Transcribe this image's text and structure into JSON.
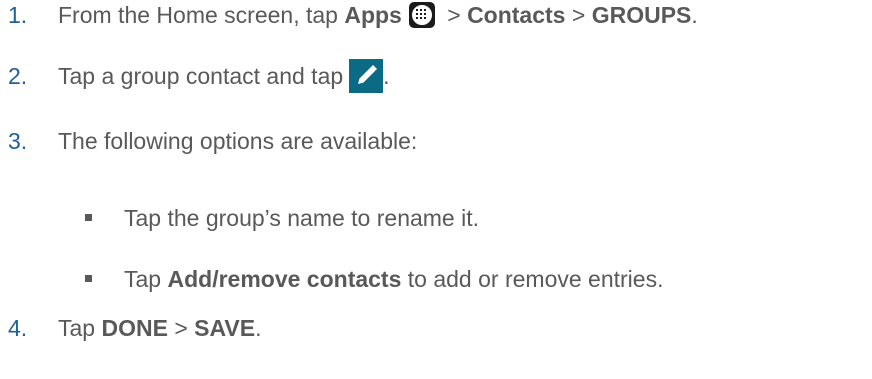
{
  "steps": [
    {
      "number": "1.",
      "t1": "From the Home screen, tap ",
      "b1": "Apps",
      "t2": " > ",
      "b2": "Contacts",
      "t3": " > ",
      "b3": "GROUPS",
      "t4": "."
    },
    {
      "number": "2.",
      "t1": "Tap a group contact and tap",
      "t2": "."
    },
    {
      "number": "3.",
      "t1": "The following options are available:"
    },
    {
      "number": "4.",
      "t1": "Tap ",
      "b1": "DONE",
      "t2": " > ",
      "b2": "SAVE",
      "t3": "."
    }
  ],
  "bullets": [
    {
      "t1": "Tap the group’s name to rename it."
    },
    {
      "t1": "Tap ",
      "b1": "Add/remove contacts",
      "t2": " to add or remove entries."
    }
  ],
  "icons": {
    "apps": "apps-grid-icon",
    "edit": "pencil-edit-icon",
    "edit_color": "#0b6b84",
    "number_color": "#1f5f9c",
    "text_color": "#595959"
  }
}
